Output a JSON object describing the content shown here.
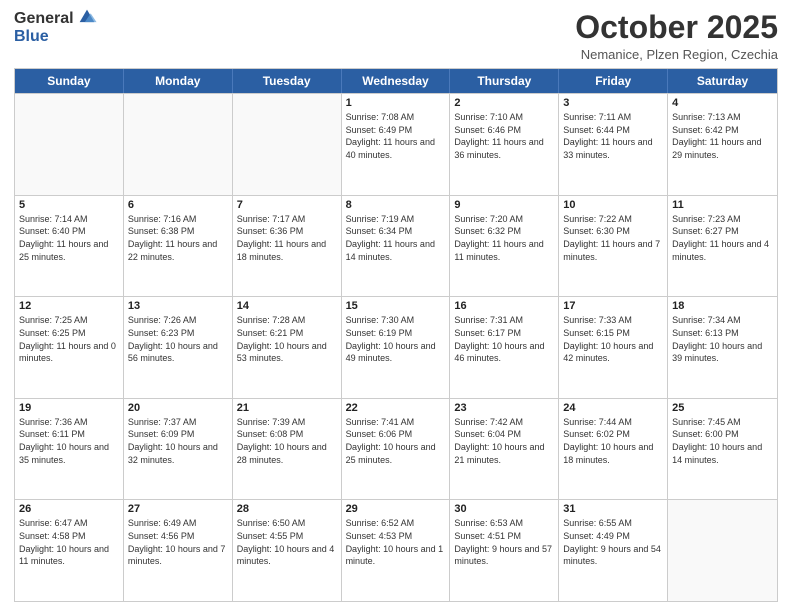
{
  "header": {
    "logo": {
      "line1": "General",
      "line2": "Blue"
    },
    "title": "October 2025",
    "location": "Nemanice, Plzen Region, Czechia"
  },
  "days_of_week": [
    "Sunday",
    "Monday",
    "Tuesday",
    "Wednesday",
    "Thursday",
    "Friday",
    "Saturday"
  ],
  "weeks": [
    [
      {
        "day": "",
        "info": ""
      },
      {
        "day": "",
        "info": ""
      },
      {
        "day": "",
        "info": ""
      },
      {
        "day": "1",
        "info": "Sunrise: 7:08 AM\nSunset: 6:49 PM\nDaylight: 11 hours and 40 minutes."
      },
      {
        "day": "2",
        "info": "Sunrise: 7:10 AM\nSunset: 6:46 PM\nDaylight: 11 hours and 36 minutes."
      },
      {
        "day": "3",
        "info": "Sunrise: 7:11 AM\nSunset: 6:44 PM\nDaylight: 11 hours and 33 minutes."
      },
      {
        "day": "4",
        "info": "Sunrise: 7:13 AM\nSunset: 6:42 PM\nDaylight: 11 hours and 29 minutes."
      }
    ],
    [
      {
        "day": "5",
        "info": "Sunrise: 7:14 AM\nSunset: 6:40 PM\nDaylight: 11 hours and 25 minutes."
      },
      {
        "day": "6",
        "info": "Sunrise: 7:16 AM\nSunset: 6:38 PM\nDaylight: 11 hours and 22 minutes."
      },
      {
        "day": "7",
        "info": "Sunrise: 7:17 AM\nSunset: 6:36 PM\nDaylight: 11 hours and 18 minutes."
      },
      {
        "day": "8",
        "info": "Sunrise: 7:19 AM\nSunset: 6:34 PM\nDaylight: 11 hours and 14 minutes."
      },
      {
        "day": "9",
        "info": "Sunrise: 7:20 AM\nSunset: 6:32 PM\nDaylight: 11 hours and 11 minutes."
      },
      {
        "day": "10",
        "info": "Sunrise: 7:22 AM\nSunset: 6:30 PM\nDaylight: 11 hours and 7 minutes."
      },
      {
        "day": "11",
        "info": "Sunrise: 7:23 AM\nSunset: 6:27 PM\nDaylight: 11 hours and 4 minutes."
      }
    ],
    [
      {
        "day": "12",
        "info": "Sunrise: 7:25 AM\nSunset: 6:25 PM\nDaylight: 11 hours and 0 minutes."
      },
      {
        "day": "13",
        "info": "Sunrise: 7:26 AM\nSunset: 6:23 PM\nDaylight: 10 hours and 56 minutes."
      },
      {
        "day": "14",
        "info": "Sunrise: 7:28 AM\nSunset: 6:21 PM\nDaylight: 10 hours and 53 minutes."
      },
      {
        "day": "15",
        "info": "Sunrise: 7:30 AM\nSunset: 6:19 PM\nDaylight: 10 hours and 49 minutes."
      },
      {
        "day": "16",
        "info": "Sunrise: 7:31 AM\nSunset: 6:17 PM\nDaylight: 10 hours and 46 minutes."
      },
      {
        "day": "17",
        "info": "Sunrise: 7:33 AM\nSunset: 6:15 PM\nDaylight: 10 hours and 42 minutes."
      },
      {
        "day": "18",
        "info": "Sunrise: 7:34 AM\nSunset: 6:13 PM\nDaylight: 10 hours and 39 minutes."
      }
    ],
    [
      {
        "day": "19",
        "info": "Sunrise: 7:36 AM\nSunset: 6:11 PM\nDaylight: 10 hours and 35 minutes."
      },
      {
        "day": "20",
        "info": "Sunrise: 7:37 AM\nSunset: 6:09 PM\nDaylight: 10 hours and 32 minutes."
      },
      {
        "day": "21",
        "info": "Sunrise: 7:39 AM\nSunset: 6:08 PM\nDaylight: 10 hours and 28 minutes."
      },
      {
        "day": "22",
        "info": "Sunrise: 7:41 AM\nSunset: 6:06 PM\nDaylight: 10 hours and 25 minutes."
      },
      {
        "day": "23",
        "info": "Sunrise: 7:42 AM\nSunset: 6:04 PM\nDaylight: 10 hours and 21 minutes."
      },
      {
        "day": "24",
        "info": "Sunrise: 7:44 AM\nSunset: 6:02 PM\nDaylight: 10 hours and 18 minutes."
      },
      {
        "day": "25",
        "info": "Sunrise: 7:45 AM\nSunset: 6:00 PM\nDaylight: 10 hours and 14 minutes."
      }
    ],
    [
      {
        "day": "26",
        "info": "Sunrise: 6:47 AM\nSunset: 4:58 PM\nDaylight: 10 hours and 11 minutes."
      },
      {
        "day": "27",
        "info": "Sunrise: 6:49 AM\nSunset: 4:56 PM\nDaylight: 10 hours and 7 minutes."
      },
      {
        "day": "28",
        "info": "Sunrise: 6:50 AM\nSunset: 4:55 PM\nDaylight: 10 hours and 4 minutes."
      },
      {
        "day": "29",
        "info": "Sunrise: 6:52 AM\nSunset: 4:53 PM\nDaylight: 10 hours and 1 minute."
      },
      {
        "day": "30",
        "info": "Sunrise: 6:53 AM\nSunset: 4:51 PM\nDaylight: 9 hours and 57 minutes."
      },
      {
        "day": "31",
        "info": "Sunrise: 6:55 AM\nSunset: 4:49 PM\nDaylight: 9 hours and 54 minutes."
      },
      {
        "day": "",
        "info": ""
      }
    ]
  ]
}
